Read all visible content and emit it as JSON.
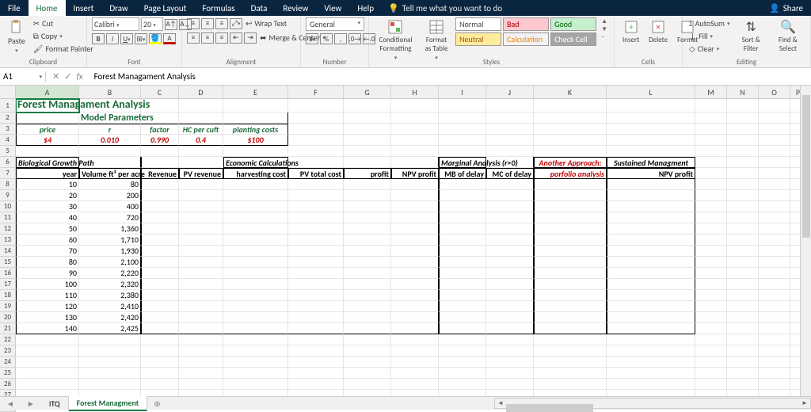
{
  "ribbon_tabs": [
    "File",
    "Home",
    "Insert",
    "Draw",
    "Page Layout",
    "Formulas",
    "Data",
    "Review",
    "View",
    "Help"
  ],
  "active_tab": "Home",
  "tellme": "Tell me what you want to do",
  "share": "Share",
  "clipboard": {
    "paste": "Paste",
    "cut": "Cut",
    "copy": "Copy",
    "fp": "Format Painter",
    "label": "Clipboard"
  },
  "font": {
    "name": "Calibri",
    "size": "20",
    "label": "Font"
  },
  "alignment": {
    "wrap": "Wrap Text",
    "merge": "Merge & Center",
    "label": "Alignment"
  },
  "number": {
    "fmt": "General",
    "label": "Number"
  },
  "stylesgrp": {
    "cond": "Conditional Formatting",
    "tbl": "Format as Table",
    "normal": "Normal",
    "bad": "Bad",
    "good": "Good",
    "neutral": "Neutral",
    "calc": "Calculation",
    "check": "Check Cell",
    "label": "Styles"
  },
  "cellsgrp": {
    "insert": "Insert",
    "delete": "Delete",
    "format": "Format",
    "label": "Cells"
  },
  "editing": {
    "autosum": "AutoSum",
    "fill": "Fill",
    "clear": "Clear",
    "sort": "Sort & Filter",
    "find": "Find & Select",
    "label": "Editing"
  },
  "namebox": "A1",
  "formula": "Forest Managament Analysis",
  "cols": [
    "A",
    "B",
    "C",
    "D",
    "E",
    "F",
    "G",
    "H",
    "I",
    "J",
    "K",
    "L",
    "M",
    "N",
    "O",
    "P"
  ],
  "title": "Forest Managament Analysis",
  "subtitle": "Model Parameters",
  "params_head": {
    "price": "price",
    "r": "r",
    "factor": "factor",
    "hc": "HC per cuft",
    "plant": "planting costs"
  },
  "params_val": {
    "price": "$4",
    "r": "0.010",
    "factor": "0.990",
    "hc": "0.4",
    "plant": "$100"
  },
  "sections": {
    "bio": "Biological Growth Path",
    "econ": "Economic Calculations",
    "marg": "Marginal Analysis (r>0)",
    "another": "Another Approach:",
    "sustained": "Sustained Managment"
  },
  "headers": {
    "year": "year",
    "vol": "Volume ft³ per acre",
    "rev": "Revenue",
    "pvrev": "PV revenue",
    "harv": "harvesting cost",
    "pvtot": "PV total cost",
    "profit": "profit",
    "npv": "NPV profit",
    "mb": "MB of delay",
    "mc": "MC of delay",
    "porf": "porfolio analysis",
    "npv2": "NPV profit"
  },
  "data_rows": [
    {
      "year": "10",
      "vol": "80"
    },
    {
      "year": "20",
      "vol": "200"
    },
    {
      "year": "30",
      "vol": "400"
    },
    {
      "year": "40",
      "vol": "720"
    },
    {
      "year": "50",
      "vol": "1,360"
    },
    {
      "year": "60",
      "vol": "1,710"
    },
    {
      "year": "70",
      "vol": "1,930"
    },
    {
      "year": "80",
      "vol": "2,100"
    },
    {
      "year": "90",
      "vol": "2,220"
    },
    {
      "year": "100",
      "vol": "2,320"
    },
    {
      "year": "110",
      "vol": "2,380"
    },
    {
      "year": "120",
      "vol": "2,410"
    },
    {
      "year": "130",
      "vol": "2,420"
    },
    {
      "year": "140",
      "vol": "2,425"
    }
  ],
  "sheets": {
    "itq": "ITQ",
    "forest": "Forest Managment"
  }
}
